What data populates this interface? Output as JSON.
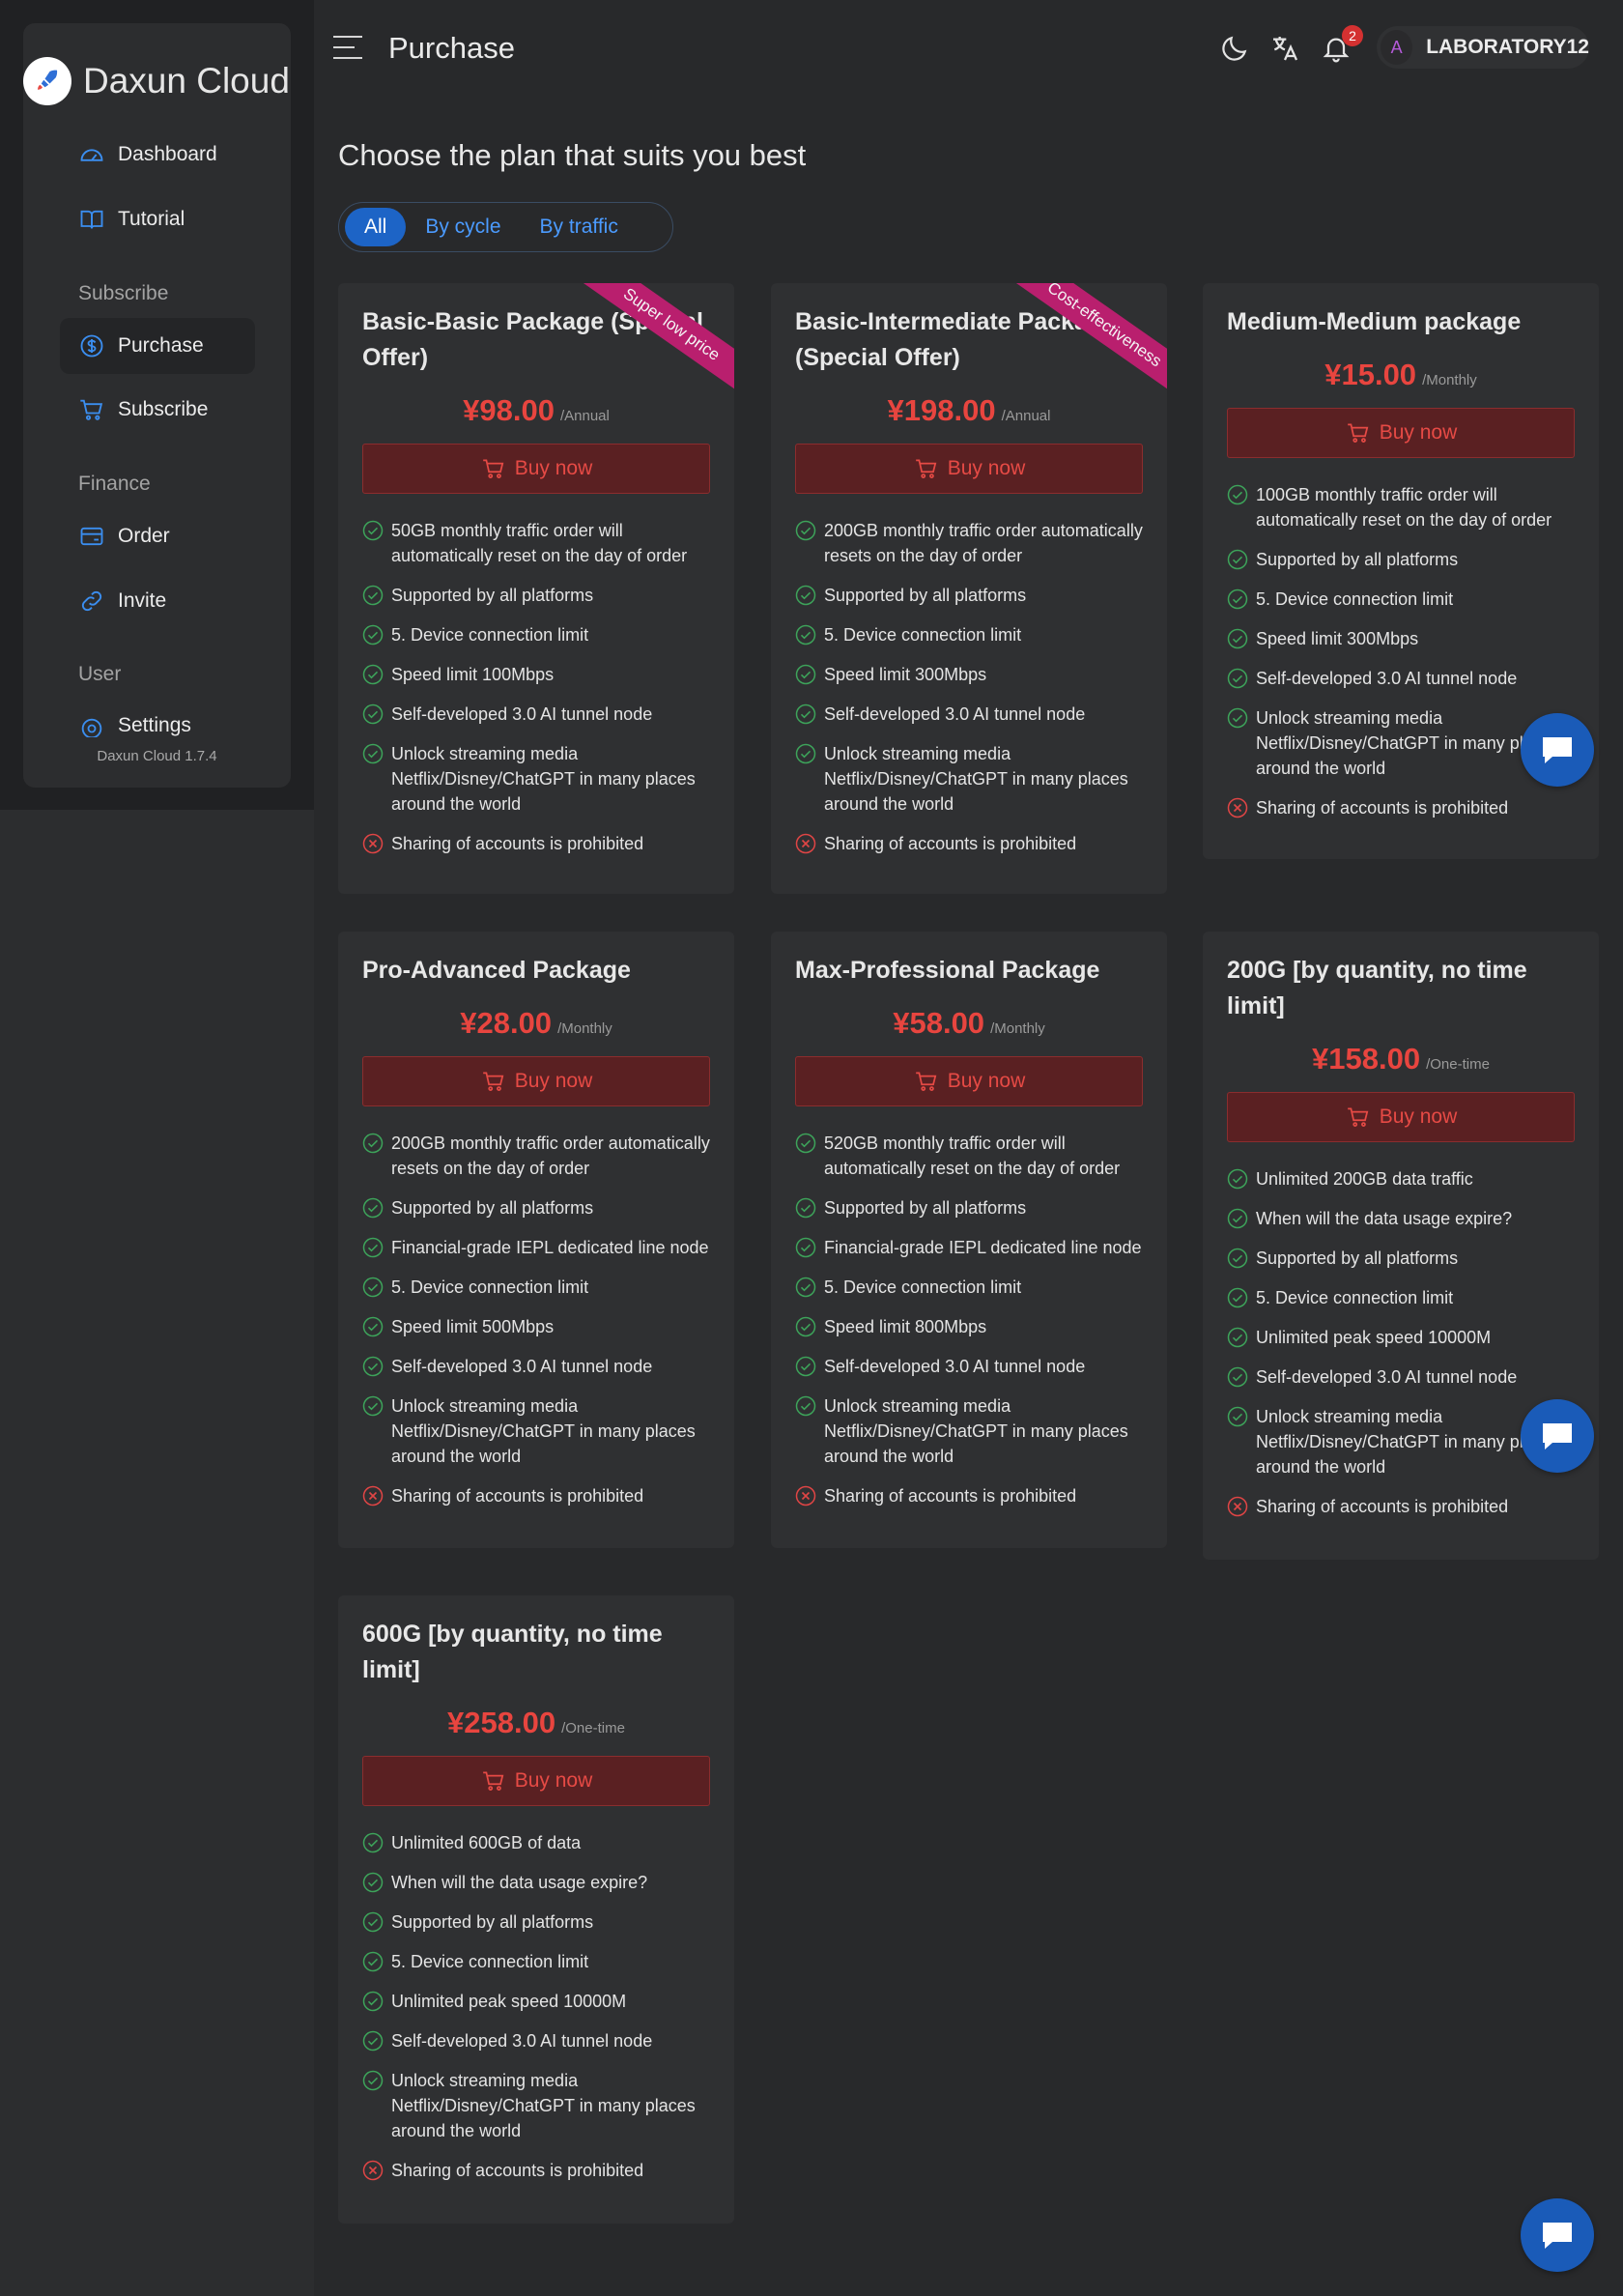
{
  "brand": {
    "name": "Daxun Cloud",
    "version": "Daxun Cloud 1.7.4"
  },
  "nav": {
    "dashboard": "Dashboard",
    "tutorial": "Tutorial",
    "section_subscribe": "Subscribe",
    "purchase": "Purchase",
    "subscribe": "Subscribe",
    "section_finance": "Finance",
    "order": "Order",
    "invite": "Invite",
    "section_user": "User",
    "settings": "Settings"
  },
  "header": {
    "title": "Purchase",
    "notification_count": "2",
    "user_initial": "A",
    "user_name": "LABORATORY12"
  },
  "main": {
    "title": "Choose the plan that suits you best",
    "tabs": [
      "All",
      "By cycle",
      "By traffic"
    ],
    "buy_label": "Buy now"
  },
  "colors": {
    "accent": "#1d64c6",
    "price": "#e8453f",
    "ribbon": "#b91f6e",
    "check": "#3da35a",
    "cross": "#e04545"
  },
  "plans": [
    {
      "title": "Basic-Basic Package (Special Offer)",
      "ribbon": "Super low price",
      "price": "¥98.00",
      "cycle": "/Annual",
      "features": [
        {
          "text": "50GB monthly traffic order will automatically reset on the day of order",
          "ok": true
        },
        {
          "text": "Supported by all platforms",
          "ok": true
        },
        {
          "text": "5. Device connection limit",
          "ok": true
        },
        {
          "text": "Speed limit 100Mbps",
          "ok": true
        },
        {
          "text": "Self-developed 3.0 AI tunnel node",
          "ok": true
        },
        {
          "text": "Unlock streaming media Netflix/Disney/ChatGPT in many places around the world",
          "ok": true
        },
        {
          "text": "Sharing of accounts is prohibited",
          "ok": false
        }
      ]
    },
    {
      "title": "Basic-Intermediate Package (Special Offer)",
      "ribbon": "Cost-effectiveness",
      "price": "¥198.00",
      "cycle": "/Annual",
      "features": [
        {
          "text": "200GB monthly traffic order automatically resets on the day of order",
          "ok": true
        },
        {
          "text": "Supported by all platforms",
          "ok": true
        },
        {
          "text": "5. Device connection limit",
          "ok": true
        },
        {
          "text": "Speed limit 300Mbps",
          "ok": true
        },
        {
          "text": "Self-developed 3.0 AI tunnel node",
          "ok": true
        },
        {
          "text": "Unlock streaming media Netflix/Disney/ChatGPT in many places around the world",
          "ok": true
        },
        {
          "text": "Sharing of accounts is prohibited",
          "ok": false
        }
      ]
    },
    {
      "title": "Medium-Medium package",
      "ribbon": "",
      "price": "¥15.00",
      "cycle": "/Monthly",
      "features": [
        {
          "text": "100GB monthly traffic order will automatically reset on the day of order",
          "ok": true
        },
        {
          "text": "Supported by all platforms",
          "ok": true
        },
        {
          "text": "5. Device connection limit",
          "ok": true
        },
        {
          "text": "Speed limit 300Mbps",
          "ok": true
        },
        {
          "text": "Self-developed 3.0 AI tunnel node",
          "ok": true
        },
        {
          "text": "Unlock streaming media Netflix/Disney/ChatGPT in many places around the world",
          "ok": true
        },
        {
          "text": "Sharing of accounts is prohibited",
          "ok": false
        }
      ]
    },
    {
      "title": "Pro-Advanced Package",
      "ribbon": "",
      "price": "¥28.00",
      "cycle": "/Monthly",
      "features": [
        {
          "text": "200GB monthly traffic order automatically resets on the day of order",
          "ok": true
        },
        {
          "text": "Supported by all platforms",
          "ok": true
        },
        {
          "text": "Financial-grade IEPL dedicated line node",
          "ok": true
        },
        {
          "text": "5. Device connection limit",
          "ok": true
        },
        {
          "text": "Speed limit 500Mbps",
          "ok": true
        },
        {
          "text": "Self-developed 3.0 AI tunnel node",
          "ok": true
        },
        {
          "text": "Unlock streaming media Netflix/Disney/ChatGPT in many places around the world",
          "ok": true
        },
        {
          "text": "Sharing of accounts is prohibited",
          "ok": false
        }
      ]
    },
    {
      "title": "Max-Professional Package",
      "ribbon": "",
      "price": "¥58.00",
      "cycle": "/Monthly",
      "features": [
        {
          "text": "520GB monthly traffic order will automatically reset on the day of order",
          "ok": true
        },
        {
          "text": "Supported by all platforms",
          "ok": true
        },
        {
          "text": "Financial-grade IEPL dedicated line node",
          "ok": true
        },
        {
          "text": "5. Device connection limit",
          "ok": true
        },
        {
          "text": "Speed limit 800Mbps",
          "ok": true
        },
        {
          "text": "Self-developed 3.0 AI tunnel node",
          "ok": true
        },
        {
          "text": "Unlock streaming media Netflix/Disney/ChatGPT in many places around the world",
          "ok": true
        },
        {
          "text": "Sharing of accounts is prohibited",
          "ok": false
        }
      ]
    },
    {
      "title": "200G [by quantity, no time limit]",
      "ribbon": "",
      "price": "¥158.00",
      "cycle": "/One-time",
      "features": [
        {
          "text": "Unlimited 200GB data traffic",
          "ok": true
        },
        {
          "text": "When will the data usage expire?",
          "ok": true
        },
        {
          "text": "Supported by all platforms",
          "ok": true
        },
        {
          "text": "5. Device connection limit",
          "ok": true
        },
        {
          "text": "Unlimited peak speed 10000M",
          "ok": true
        },
        {
          "text": "Self-developed 3.0 AI tunnel node",
          "ok": true
        },
        {
          "text": "Unlock streaming media Netflix/Disney/ChatGPT in many places around the world",
          "ok": true
        },
        {
          "text": "Sharing of accounts is prohibited",
          "ok": false
        }
      ]
    },
    {
      "title": "600G [by quantity, no time limit]",
      "ribbon": "",
      "price": "¥258.00",
      "cycle": "/One-time",
      "features": [
        {
          "text": "Unlimited 600GB of data",
          "ok": true
        },
        {
          "text": "When will the data usage expire?",
          "ok": true
        },
        {
          "text": "Supported by all platforms",
          "ok": true
        },
        {
          "text": "5. Device connection limit",
          "ok": true
        },
        {
          "text": "Unlimited peak speed 10000M",
          "ok": true
        },
        {
          "text": "Self-developed 3.0 AI tunnel node",
          "ok": true
        },
        {
          "text": "Unlock streaming media Netflix/Disney/ChatGPT in many places around the world",
          "ok": true
        },
        {
          "text": "Sharing of accounts is prohibited",
          "ok": false
        }
      ]
    }
  ]
}
